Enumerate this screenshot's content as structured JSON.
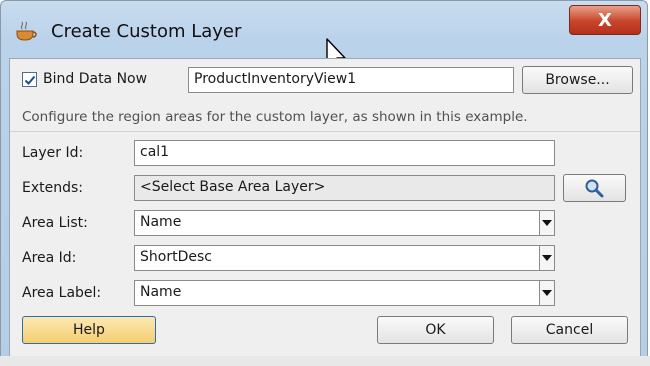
{
  "window": {
    "title": "Create Custom Layer",
    "close_glyph": "X"
  },
  "bind": {
    "checked": true,
    "label": "Bind Data Now",
    "value": "ProductInventoryView1",
    "browse_label": "Browse..."
  },
  "hint": "Configure the region areas for the custom layer, as shown in this example.",
  "fields": {
    "layer_id": {
      "label": "Layer Id:",
      "value": "cal1"
    },
    "extends": {
      "label": "Extends:",
      "value": "<Select Base Area Layer>",
      "search_icon": "magnifier-icon"
    },
    "area_list": {
      "label": "Area List:",
      "value": "Name"
    },
    "area_id": {
      "label": "Area Id:",
      "value": "ShortDesc"
    },
    "area_label": {
      "label": "Area Label:",
      "value": "Name"
    }
  },
  "buttons": {
    "help": "Help",
    "ok": "OK",
    "cancel": "Cancel"
  },
  "colors": {
    "title_bar": "#bad2ea",
    "close_button": "#c8452b",
    "primary_button": "#f5cf6f"
  }
}
